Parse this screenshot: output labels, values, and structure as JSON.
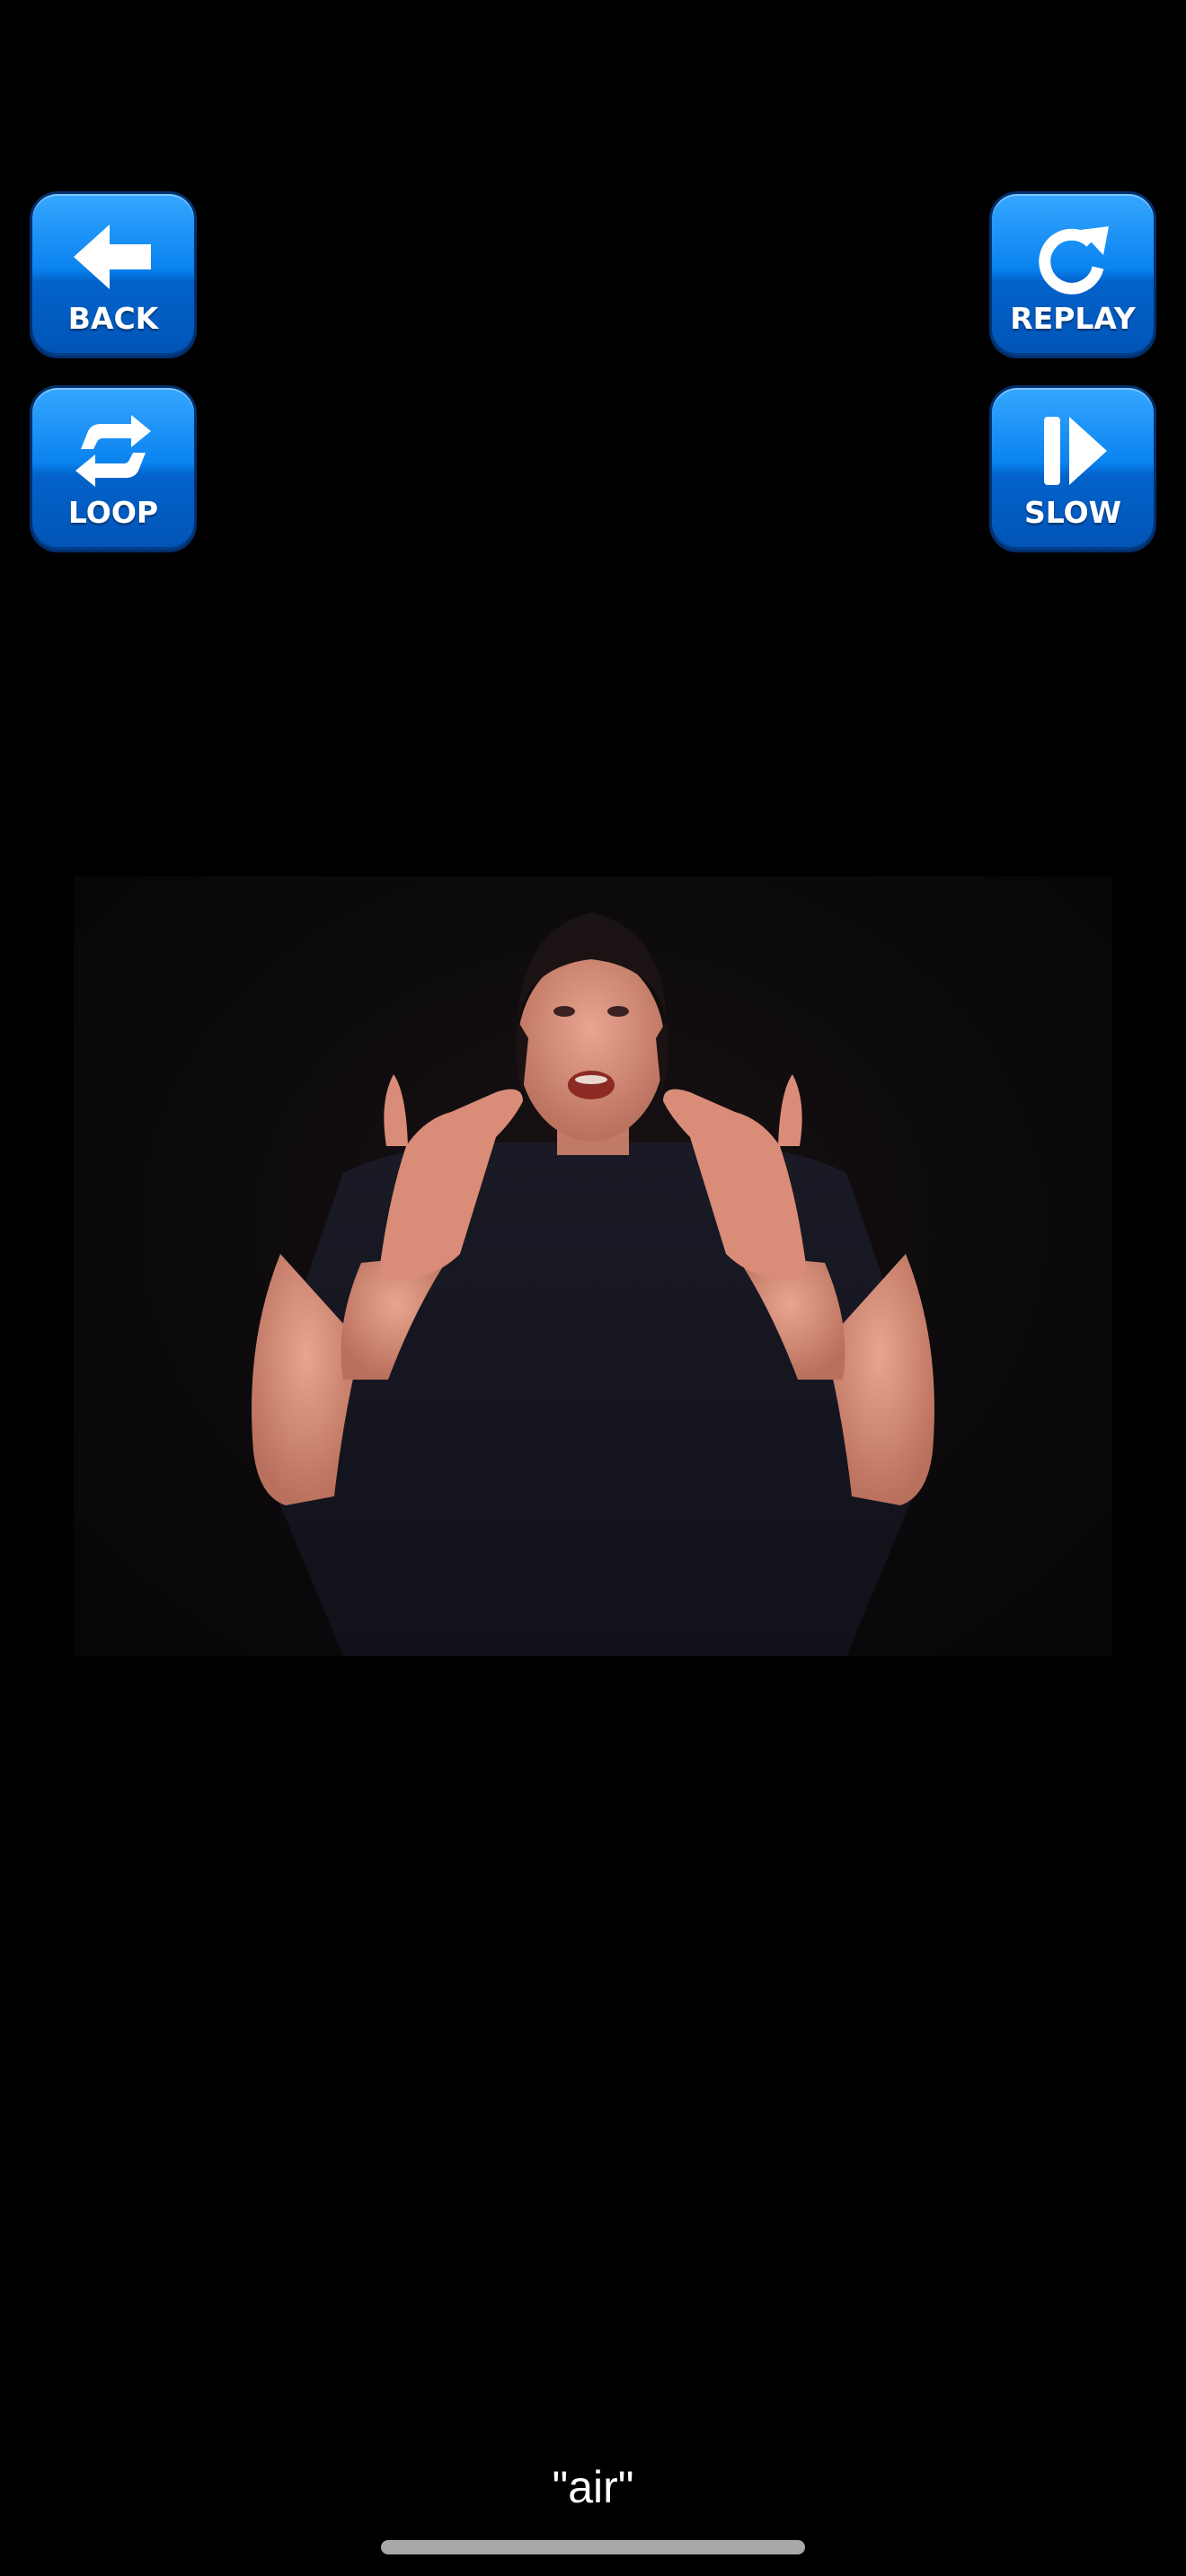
{
  "controls": {
    "back": {
      "label": "BACK",
      "icon": "back-arrow-icon"
    },
    "loop": {
      "label": "LOOP",
      "icon": "loop-arrows-icon"
    },
    "replay": {
      "label": "REPLAY",
      "icon": "replay-icon"
    },
    "slow": {
      "label": "SLOW",
      "icon": "slow-play-icon"
    }
  },
  "video": {
    "content": "sign-language-video-frame"
  },
  "caption": {
    "text": "\"air\""
  },
  "colors": {
    "background": "#000000",
    "button_top": "#35a7ff",
    "button_bottom": "#0254b6",
    "button_border": "#032f6e",
    "label": "#ffffff",
    "home_indicator": "#a8a8a8"
  }
}
